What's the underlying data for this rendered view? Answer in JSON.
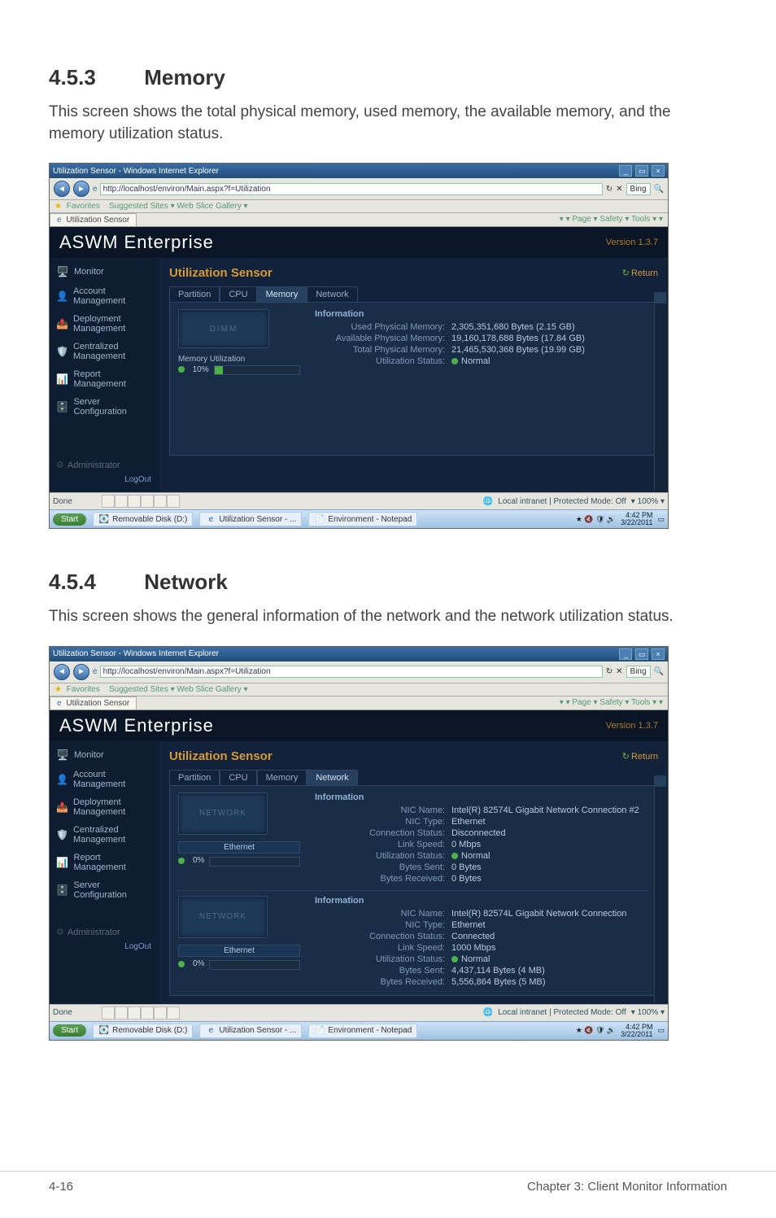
{
  "section1": {
    "num": "4.5.3",
    "title": "Memory",
    "desc": "This screen shows the total physical memory, used memory, the available memory, and the memory utilization status."
  },
  "section2": {
    "num": "4.5.4",
    "title": "Network",
    "desc": "This screen shows the general information of the network and the network utilization status."
  },
  "footer": {
    "left": "4-16",
    "right": "Chapter 3: Client Monitor Information"
  },
  "browser": {
    "window_title": "Utilization Sensor - Windows Internet Explorer",
    "url": "http://localhost/environ/Main.aspx?f=Utilization",
    "search_hint": "Bing",
    "favorites": "Favorites",
    "suggested": "Suggested Sites ▾     Web Slice Gallery ▾",
    "tab_label": "Utilization Sensor",
    "tools_row": "    ▾          ▾     Page ▾   Safety ▾   Tools ▾    ▾",
    "status_done": "Done",
    "status_mode": "Local intranet | Protected Mode: Off",
    "status_zoom": "100%",
    "taskbar": {
      "start": "Start",
      "items": [
        "Removable Disk (D:)",
        "Utilization Sensor - ...",
        "Environment - Notepad"
      ],
      "time": "4:42 PM",
      "date": "3/22/2011"
    }
  },
  "app": {
    "name": "ASWM Enterprise",
    "version": "Version 1.3.7",
    "sidebar": [
      {
        "icon": "🖥️",
        "label": "Monitor"
      },
      {
        "icon": "👤",
        "label": "Account Management"
      },
      {
        "icon": "📤",
        "label": "Deployment Management"
      },
      {
        "icon": "🛡️",
        "label": "Centralized Management"
      },
      {
        "icon": "📊",
        "label": "Report Management"
      },
      {
        "icon": "🗄️",
        "label": "Server Configuration"
      }
    ],
    "admin": "Administrator",
    "logout": "LogOut",
    "page_title": "Utilization Sensor",
    "return": "Return",
    "tabs": [
      "Partition",
      "CPU",
      "Memory",
      "Network"
    ]
  },
  "memory": {
    "gauge_label": "Memory Utilization",
    "percent_text": "10%",
    "percent": 10,
    "chip_label": "DIMM",
    "info_title": "Information",
    "rows": [
      {
        "k": "Used Physical Memory:",
        "v": "2,305,351,680 Bytes (2.15 GB)"
      },
      {
        "k": "Available Physical Memory:",
        "v": "19,160,178,688 Bytes (17.84 GB)"
      },
      {
        "k": "Total Physical Memory:",
        "v": "21,465,530,368 Bytes (19.99 GB)"
      },
      {
        "k": "Utilization Status:",
        "v": "Normal",
        "dot": "green"
      }
    ]
  },
  "network": {
    "gauge_label": "Ethernet",
    "percent_text": "0%",
    "percent": 0,
    "card_label": "NETWORK",
    "info_title": "Information",
    "nic1": [
      {
        "k": "NIC Name:",
        "v": "Intel(R) 82574L Gigabit Network Connection #2"
      },
      {
        "k": "NIC Type:",
        "v": "Ethernet"
      },
      {
        "k": "Connection Status:",
        "v": "Disconnected"
      },
      {
        "k": "Link Speed:",
        "v": "0 Mbps"
      },
      {
        "k": "Utilization Status:",
        "v": "Normal",
        "dot": "green"
      },
      {
        "k": "Bytes Sent:",
        "v": "0 Bytes"
      },
      {
        "k": "Bytes Received:",
        "v": "0 Bytes"
      }
    ],
    "gauge2_label": "Ethernet",
    "percent2_text": "0%",
    "nic2": [
      {
        "k": "NIC Name:",
        "v": "Intel(R) 82574L Gigabit Network Connection"
      },
      {
        "k": "NIC Type:",
        "v": "Ethernet"
      },
      {
        "k": "Connection Status:",
        "v": "Connected"
      },
      {
        "k": "Link Speed:",
        "v": "1000 Mbps"
      },
      {
        "k": "Utilization Status:",
        "v": "Normal",
        "dot": "green"
      },
      {
        "k": "Bytes Sent:",
        "v": "4,437,114 Bytes (4 MB)"
      },
      {
        "k": "Bytes Received:",
        "v": "5,556,864 Bytes (5 MB)"
      }
    ]
  }
}
